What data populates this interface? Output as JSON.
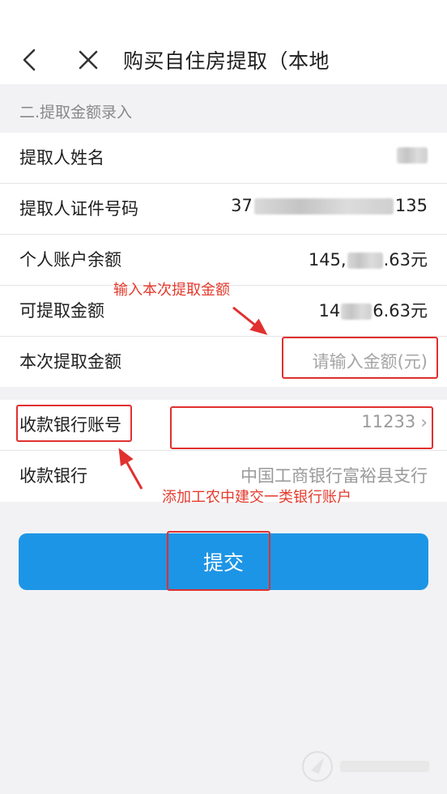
{
  "header": {
    "title": "购买自住房提取（本地"
  },
  "section": {
    "label": "二.提取金额录入"
  },
  "fields": [
    {
      "label": "提取人姓名"
    },
    {
      "label": "提取人证件号码",
      "value_prefix": "37",
      "value_suffix": "135"
    },
    {
      "label": "个人账户余额",
      "value_prefix": "145,",
      "value_suffix": ".63元"
    },
    {
      "label": "可提取金额",
      "value_prefix": "14",
      "value_suffix": "6.63元"
    },
    {
      "label": "本次提取金额",
      "placeholder": "请输入金额(元)"
    }
  ],
  "bank": {
    "account_label": "收款银行账号",
    "account_value": "11233",
    "bank_label": "收款银行",
    "bank_value": "中国工商银行富裕县支行"
  },
  "annotations": {
    "amount_hint": "输入本次提取金额",
    "bank_hint": "添加工农中建交一类银行账户",
    "color": "#e0302f"
  },
  "submit": {
    "label": "提交",
    "color": "#1d95e6"
  }
}
